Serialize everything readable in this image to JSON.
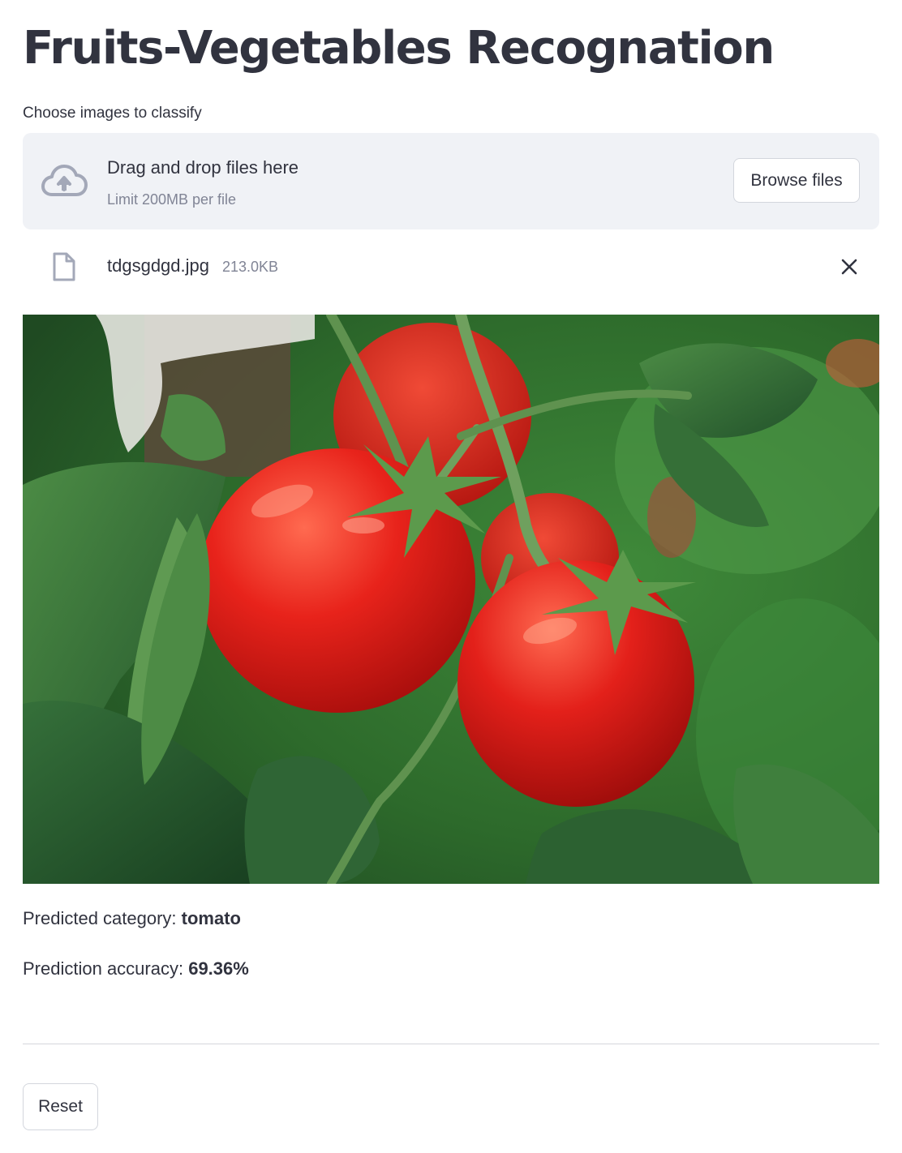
{
  "page": {
    "title": "Fruits-Vegetables Recognation"
  },
  "uploader": {
    "label": "Choose images to classify",
    "dropzone_text": "Drag and drop files here",
    "limit_text": "Limit 200MB per file",
    "browse_button": "Browse files",
    "icon": "cloud-upload-icon"
  },
  "uploaded_file": {
    "name": "tdgsgdgd.jpg",
    "size": "213.0KB",
    "icon": "file-icon",
    "remove_icon": "close-icon"
  },
  "image": {
    "description_icon": "tomato-photo"
  },
  "result": {
    "category_label": "Predicted category: ",
    "category_value": "tomato",
    "accuracy_label": "Prediction accuracy: ",
    "accuracy_value": "69.36%"
  },
  "actions": {
    "reset_button": "Reset"
  },
  "colors": {
    "text": "#31333f",
    "muted": "#808495",
    "dropzone_bg": "#f0f2f6",
    "border": "#d3d6dd"
  }
}
